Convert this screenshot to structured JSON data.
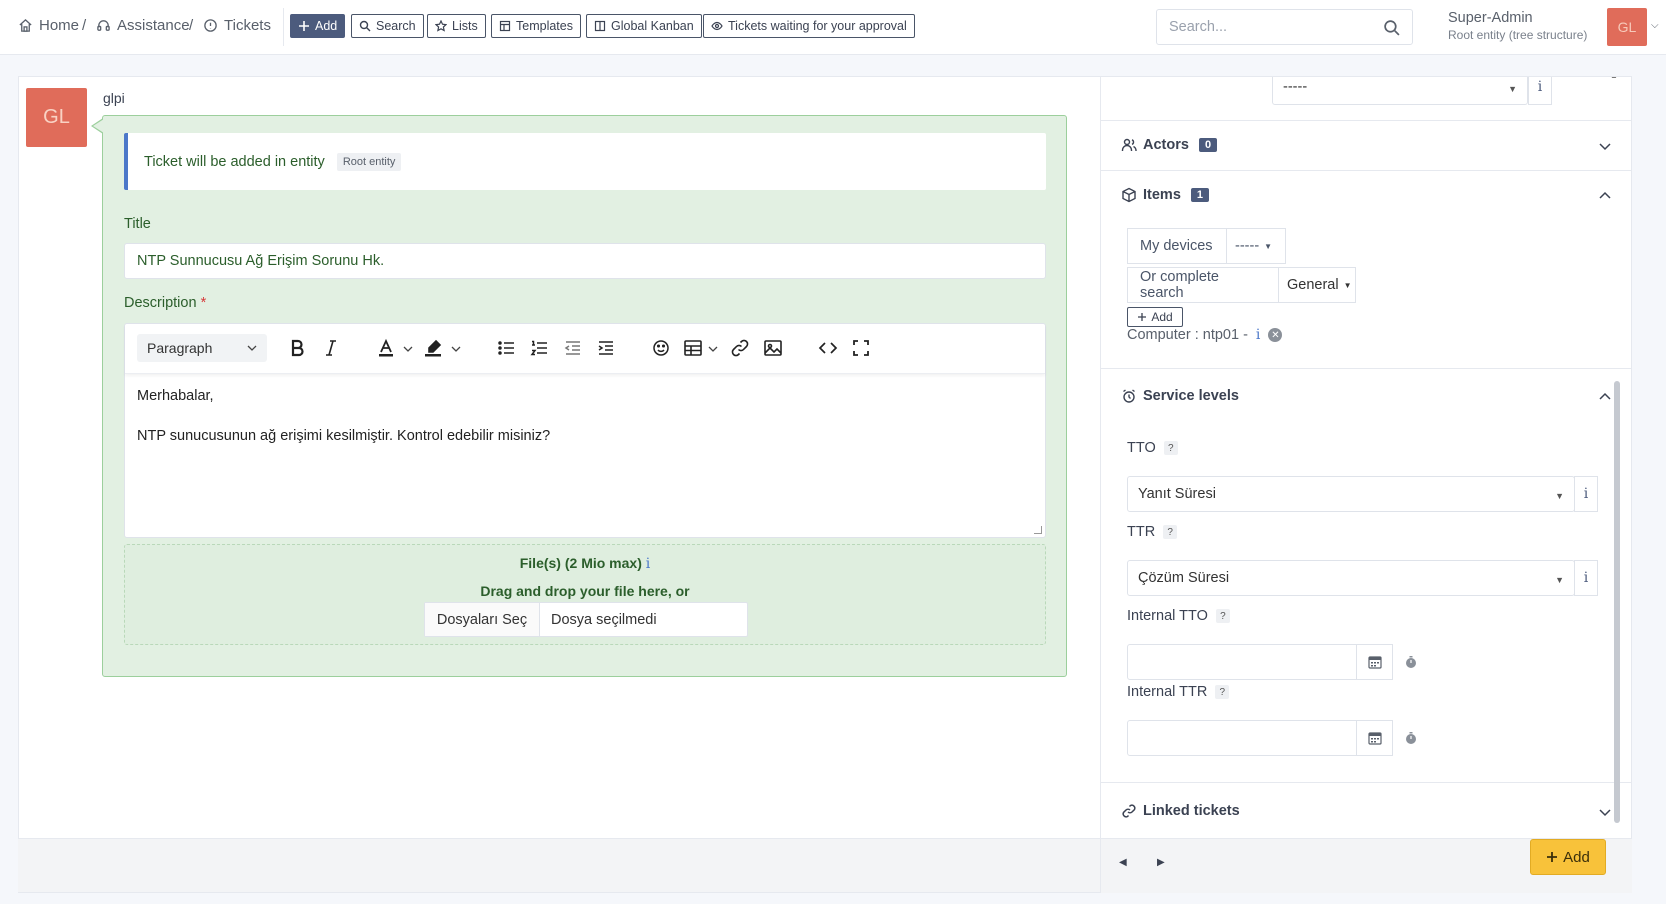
{
  "breadcrumb": {
    "home": "Home",
    "assistance": "Assistance",
    "tickets": "Tickets"
  },
  "toolbar": {
    "add": "Add",
    "search": "Search",
    "lists": "Lists",
    "templates": "Templates",
    "kanban": "Global Kanban",
    "approval": "Tickets waiting for your approval"
  },
  "header": {
    "search_placeholder": "Search...",
    "user_name": "Super-Admin",
    "user_entity": "Root entity (tree structure)",
    "user_initials": "GL"
  },
  "ticket": {
    "author_initials": "GL",
    "author": "glpi",
    "entity_notice": "Ticket will be added in entity",
    "entity_badge": "Root entity",
    "title_label": "Title",
    "title_value": "NTP Sunnucusu Ağ Erişim Sorunu Hk.",
    "description_label": "Description",
    "required_mark": "*",
    "paragraph": "Paragraph",
    "body_line1": "Merhabalar,",
    "body_line2": "NTP sunucusunun ağ erişimi kesilmiştir. Kontrol edebilir misiniz?",
    "files_title": "File(s) (2 Mio max)",
    "files_info": "i",
    "drag_text": "Drag and drop your file here, or",
    "choose_files": "Dosyaları Seç",
    "no_file": "Dosya seçilmedi"
  },
  "right": {
    "top_select": "-----",
    "info": "i",
    "actors_label": "Actors",
    "actors_count": "0",
    "items_label": "Items",
    "items_count": "1",
    "my_devices": "My devices",
    "devices_select": "-----",
    "complete_search": "Or complete search",
    "general": "General",
    "add_item": "Add",
    "computer_item": "Computer : ntp01 -",
    "service_levels": "Service levels",
    "tto_label": "TTO",
    "tto_value": "Yanıt Süresi",
    "ttr_label": "TTR",
    "ttr_value": "Çözüm Süresi",
    "internal_tto": "Internal TTO",
    "internal_ttr": "Internal TTR",
    "qmark": "?",
    "linked_tickets": "Linked tickets",
    "add_button": "Add"
  },
  "colors": {
    "accent": "#4c5b7d",
    "success_bg": "#e2f0e2",
    "add_yellow": "#f8c23a",
    "avatar": "#e06c5a"
  }
}
